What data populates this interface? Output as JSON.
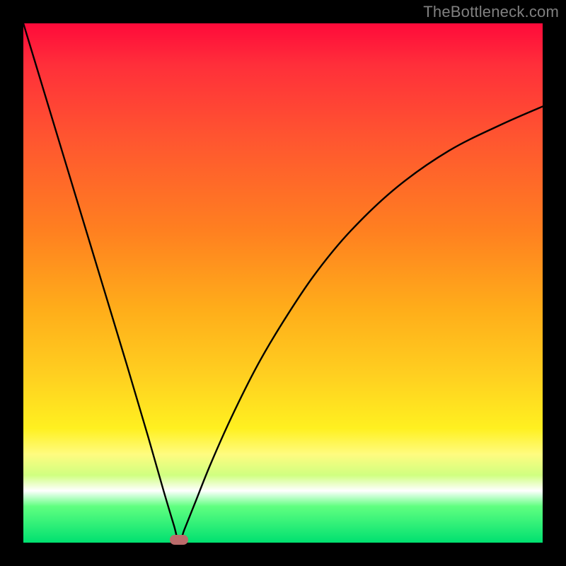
{
  "watermark_text": "TheBottleneck.com",
  "chart_data": {
    "type": "line",
    "title": "",
    "xlabel": "",
    "ylabel": "",
    "xlim": [
      0,
      100
    ],
    "ylim": [
      0,
      100
    ],
    "note": "V-shaped bottleneck curve on a red-to-green vertical gradient. Minimum (optimal point) near x≈30. Left branch is steep and nearly linear from top-left to the minimum; right branch rises with decreasing slope toward the right edge, ending near y≈84.",
    "series": [
      {
        "name": "bottleneck-curve",
        "x": [
          0,
          5,
          10,
          15,
          20,
          24,
          27,
          29,
          30,
          31,
          33,
          36,
          40,
          45,
          50,
          56,
          63,
          72,
          82,
          92,
          100
        ],
        "y": [
          100,
          83.5,
          67,
          50.5,
          34,
          20.5,
          10,
          3.3,
          0,
          2.5,
          7.5,
          15,
          24,
          34,
          42.5,
          51.5,
          60,
          68.5,
          75.5,
          80.5,
          84
        ]
      }
    ],
    "marker": {
      "x": 30,
      "y": 0
    },
    "gradient_stops": [
      {
        "pct": 0,
        "color": "#ff0a3a"
      },
      {
        "pct": 8,
        "color": "#ff2f3a"
      },
      {
        "pct": 22,
        "color": "#ff5530"
      },
      {
        "pct": 40,
        "color": "#ff8020"
      },
      {
        "pct": 55,
        "color": "#ffad1a"
      },
      {
        "pct": 68,
        "color": "#ffd020"
      },
      {
        "pct": 78,
        "color": "#fff020"
      },
      {
        "pct": 83,
        "color": "#fffc80"
      },
      {
        "pct": 87,
        "color": "#d0ff80"
      },
      {
        "pct": 90,
        "color": "#ffffff"
      },
      {
        "pct": 93,
        "color": "#60ff80"
      },
      {
        "pct": 100,
        "color": "#00e070"
      }
    ]
  }
}
